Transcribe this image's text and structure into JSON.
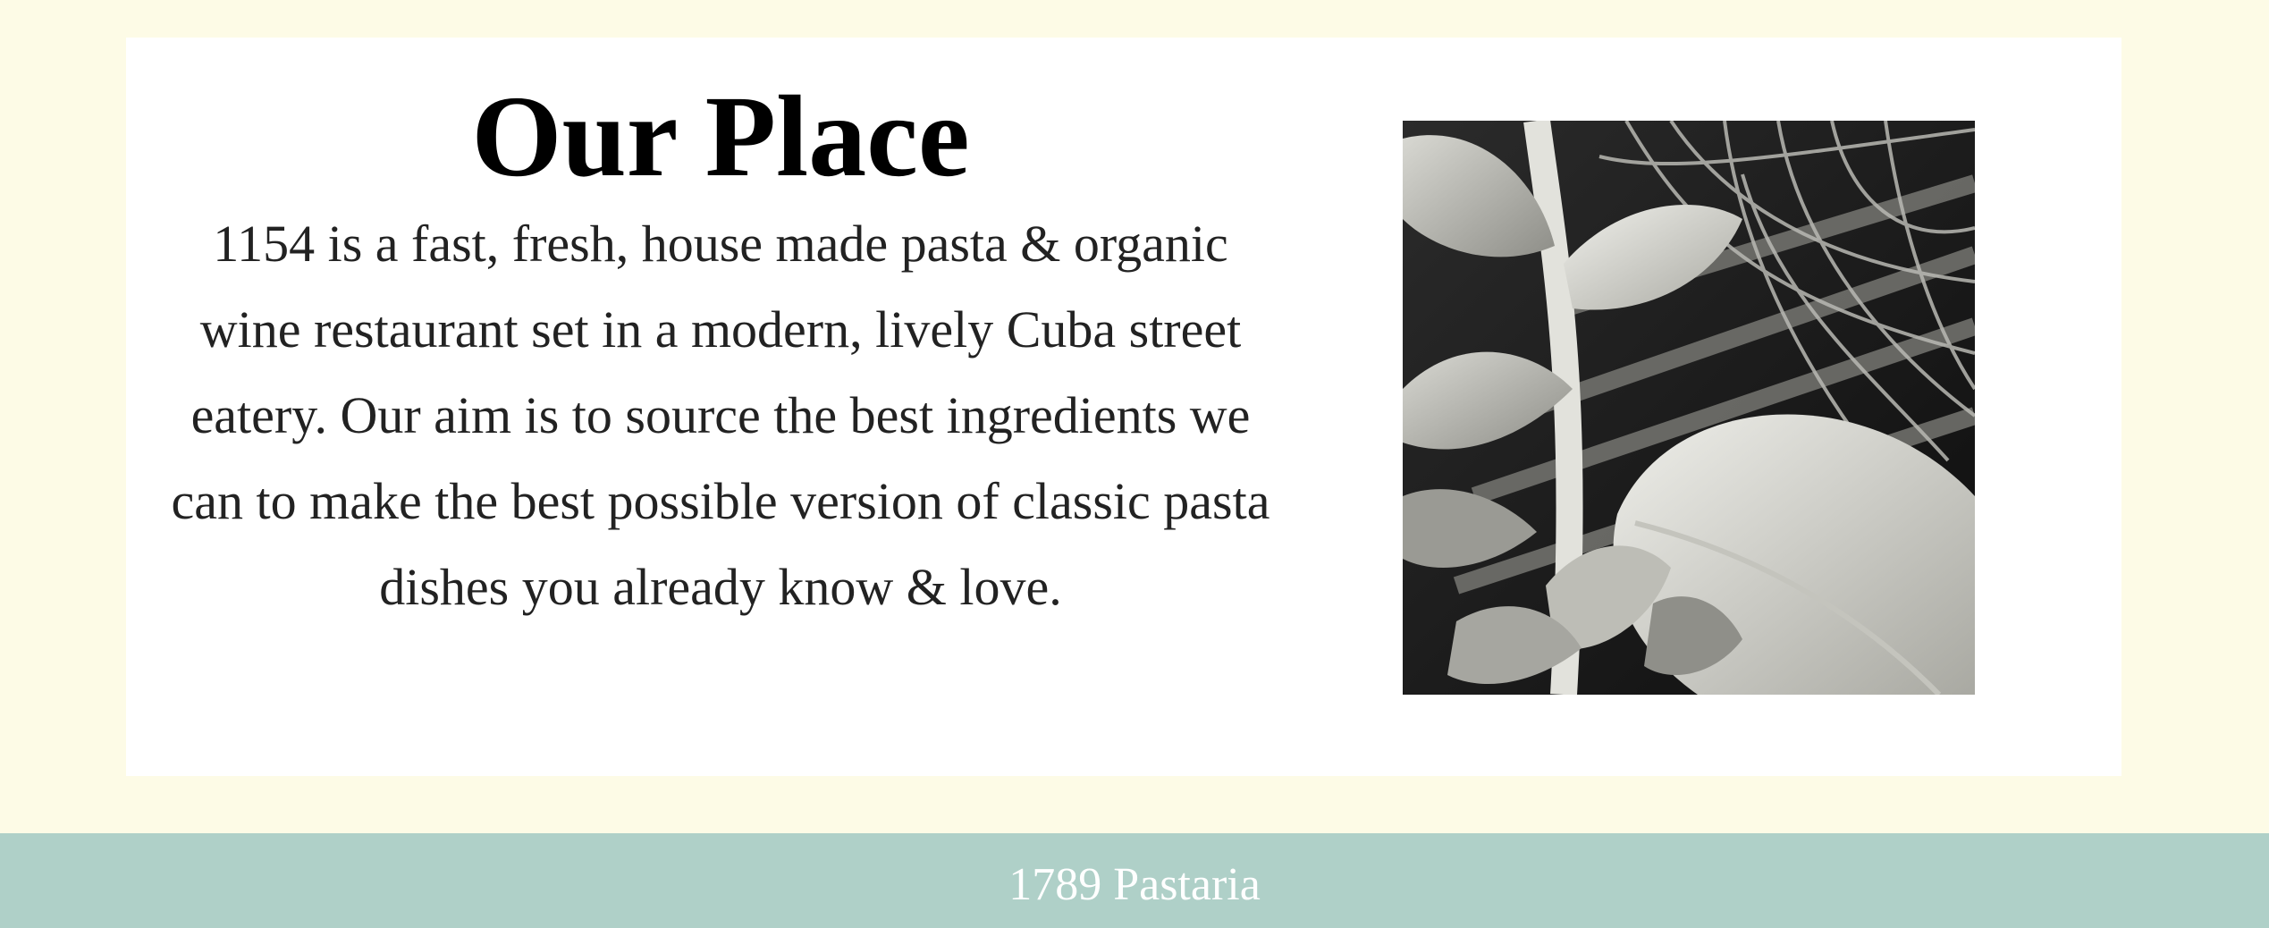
{
  "about": {
    "title": "Our Place",
    "description": "1154 is a fast, fresh, house made pasta & organic wine restaurant set in a modern, lively Cuba street eatery. Our aim is to source the best ingredients we can to make the best possible version of classic pasta dishes you already know & love."
  },
  "footer": {
    "text": "1789 Pastaria"
  },
  "colors": {
    "page_background": "#fdfbe6",
    "card_background": "#ffffff",
    "footer_background": "#afd0c8",
    "footer_text": "#ffffff"
  }
}
